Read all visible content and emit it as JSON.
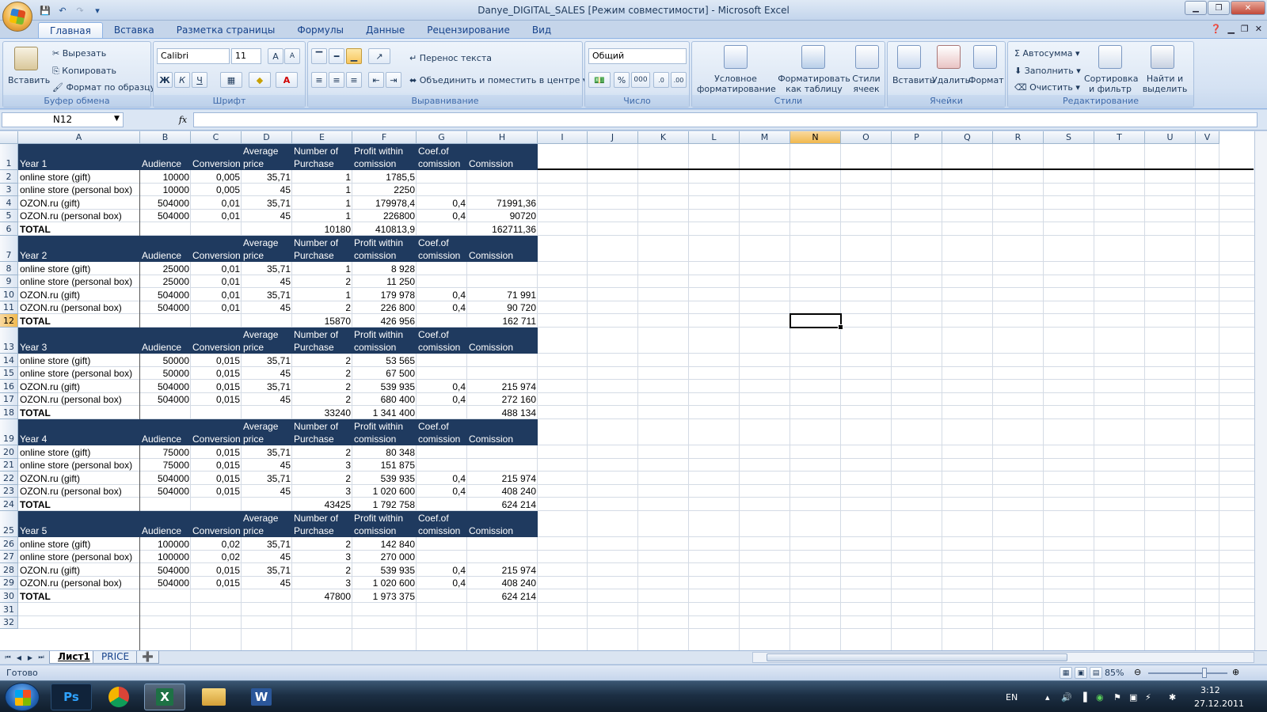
{
  "window": {
    "title": "Danye_DIGITAL_SALES  [Режим совместимости] - Microsoft Excel"
  },
  "tabs": [
    "Главная",
    "Вставка",
    "Разметка страницы",
    "Формулы",
    "Данные",
    "Рецензирование",
    "Вид"
  ],
  "ribbon": {
    "clipboard": {
      "paste": "Вставить",
      "cut": "Вырезать",
      "copy": "Копировать",
      "format_painter": "Формат по образцу",
      "label": "Буфер обмена"
    },
    "font": {
      "name": "Calibri",
      "size": "11",
      "bold": "Ж",
      "italic": "К",
      "underline": "Ч",
      "label": "Шрифт"
    },
    "alignment": {
      "wrap": "Перенос текста",
      "merge": "Объединить и поместить в центре",
      "label": "Выравнивание"
    },
    "number": {
      "format": "Общий",
      "percent": "%",
      "thousands": "000",
      "label": "Число"
    },
    "styles": {
      "conditional": "Условное форматирование",
      "as_table": "Форматировать как таблицу",
      "cell_styles": "Стили ячеек",
      "label": "Стили"
    },
    "cells": {
      "insert": "Вставить",
      "delete": "Удалить",
      "format": "Формат",
      "label": "Ячейки"
    },
    "editing": {
      "autosum": "Автосумма",
      "fill": "Заполнить",
      "clear": "Очистить",
      "sort": "Сортировка и фильтр",
      "find": "Найти и выделить",
      "label": "Редактирование"
    }
  },
  "formula_bar": {
    "name_box": "N12",
    "fx": "fx",
    "value": ""
  },
  "columns": [
    "A",
    "B",
    "C",
    "D",
    "E",
    "F",
    "G",
    "H",
    "I",
    "J",
    "K",
    "L",
    "M",
    "N",
    "O",
    "P",
    "Q",
    "R",
    "S",
    "T",
    "U",
    "V"
  ],
  "selected": {
    "column": "N",
    "row": 12
  },
  "header_labels": [
    "Audience",
    "Conversion",
    "Average\nprice",
    "Number of\nPurchase",
    "Profit within\ncomission",
    "Coef.of\ncomission",
    "Comission"
  ],
  "blocks": [
    {
      "header_row": 1,
      "year": "Year 1",
      "rows": [
        {
          "row": 2,
          "a": "online store (gift)",
          "b": "10000",
          "c": "0,005",
          "d": "35,71",
          "e": "1",
          "f": "1785,5",
          "g": "",
          "h": ""
        },
        {
          "row": 3,
          "a": "online store (personal box)",
          "b": "10000",
          "c": "0,005",
          "d": "45",
          "e": "1",
          "f": "2250",
          "g": "",
          "h": ""
        },
        {
          "row": 4,
          "a": "OZON.ru (gift)",
          "b": "504000",
          "c": "0,01",
          "d": "35,71",
          "e": "1",
          "f": "179978,4",
          "g": "0,4",
          "h": "71991,36"
        },
        {
          "row": 5,
          "a": "OZON.ru (personal box)",
          "b": "504000",
          "c": "0,01",
          "d": "45",
          "e": "1",
          "f": "226800",
          "g": "0,4",
          "h": "90720"
        }
      ],
      "total": {
        "row": 6,
        "a": "TOTAL",
        "e": "10180",
        "f": "410813,9",
        "h": "162711,36"
      }
    },
    {
      "header_row": 7,
      "year": "Year 2",
      "rows": [
        {
          "row": 8,
          "a": "online store (gift)",
          "b": "25000",
          "c": "0,01",
          "d": "35,71",
          "e": "1",
          "f": "8 928",
          "g": "",
          "h": ""
        },
        {
          "row": 9,
          "a": "online store (personal box)",
          "b": "25000",
          "c": "0,01",
          "d": "45",
          "e": "2",
          "f": "11 250",
          "g": "",
          "h": ""
        },
        {
          "row": 10,
          "a": "OZON.ru (gift)",
          "b": "504000",
          "c": "0,01",
          "d": "35,71",
          "e": "1",
          "f": "179 978",
          "g": "0,4",
          "h": "71 991"
        },
        {
          "row": 11,
          "a": "OZON.ru (personal box)",
          "b": "504000",
          "c": "0,01",
          "d": "45",
          "e": "2",
          "f": "226 800",
          "g": "0,4",
          "h": "90 720"
        }
      ],
      "total": {
        "row": 12,
        "a": "TOTAL",
        "e": "15870",
        "f": "426 956",
        "h": "162 711"
      }
    },
    {
      "header_row": 13,
      "year": "Year 3",
      "rows": [
        {
          "row": 14,
          "a": "online store (gift)",
          "b": "50000",
          "c": "0,015",
          "d": "35,71",
          "e": "2",
          "f": "53 565",
          "g": "",
          "h": ""
        },
        {
          "row": 15,
          "a": "online store (personal box)",
          "b": "50000",
          "c": "0,015",
          "d": "45",
          "e": "2",
          "f": "67 500",
          "g": "",
          "h": ""
        },
        {
          "row": 16,
          "a": "OZON.ru (gift)",
          "b": "504000",
          "c": "0,015",
          "d": "35,71",
          "e": "2",
          "f": "539 935",
          "g": "0,4",
          "h": "215 974"
        },
        {
          "row": 17,
          "a": "OZON.ru (personal box)",
          "b": "504000",
          "c": "0,015",
          "d": "45",
          "e": "2",
          "f": "680 400",
          "g": "0,4",
          "h": "272 160"
        }
      ],
      "total": {
        "row": 18,
        "a": "TOTAL",
        "e": "33240",
        "f": "1 341 400",
        "h": "488 134"
      }
    },
    {
      "header_row": 19,
      "year": "Year 4",
      "rows": [
        {
          "row": 20,
          "a": "online store (gift)",
          "b": "75000",
          "c": "0,015",
          "d": "35,71",
          "e": "2",
          "f": "80 348",
          "g": "",
          "h": ""
        },
        {
          "row": 21,
          "a": "online store (personal box)",
          "b": "75000",
          "c": "0,015",
          "d": "45",
          "e": "3",
          "f": "151 875",
          "g": "",
          "h": ""
        },
        {
          "row": 22,
          "a": "OZON.ru (gift)",
          "b": "504000",
          "c": "0,015",
          "d": "35,71",
          "e": "2",
          "f": "539 935",
          "g": "0,4",
          "h": "215 974"
        },
        {
          "row": 23,
          "a": "OZON.ru (personal box)",
          "b": "504000",
          "c": "0,015",
          "d": "45",
          "e": "3",
          "f": "1 020 600",
          "g": "0,4",
          "h": "408 240"
        }
      ],
      "total": {
        "row": 24,
        "a": "TOTAL",
        "e": "43425",
        "f": "1 792 758",
        "h": "624 214"
      }
    },
    {
      "header_row": 25,
      "year": "Year 5",
      "rows": [
        {
          "row": 26,
          "a": "online store (gift)",
          "b": "100000",
          "c": "0,02",
          "d": "35,71",
          "e": "2",
          "f": "142 840",
          "g": "",
          "h": ""
        },
        {
          "row": 27,
          "a": "online store (personal box)",
          "b": "100000",
          "c": "0,02",
          "d": "45",
          "e": "3",
          "f": "270 000",
          "g": "",
          "h": ""
        },
        {
          "row": 28,
          "a": "OZON.ru (gift)",
          "b": "504000",
          "c": "0,015",
          "d": "35,71",
          "e": "2",
          "f": "539 935",
          "g": "0,4",
          "h": "215 974"
        },
        {
          "row": 29,
          "a": "OZON.ru (personal box)",
          "b": "504000",
          "c": "0,015",
          "d": "45",
          "e": "3",
          "f": "1 020 600",
          "g": "0,4",
          "h": "408 240"
        }
      ],
      "total": {
        "row": 30,
        "a": "TOTAL",
        "e": "47800",
        "f": "1 973 375",
        "h": "624 214"
      }
    }
  ],
  "sheet_tabs": [
    "Лист1",
    "PRICE"
  ],
  "active_sheet": "Лист1",
  "status": {
    "ready": "Готово",
    "zoom": "85%"
  },
  "taskbar": {
    "lang": "EN",
    "time": "3:12",
    "date": "27.12.2011",
    "apps": [
      "Ps",
      "Chrome",
      "Excel",
      "Folder",
      "Word"
    ]
  },
  "colors": {
    "header_band": "#1f3a5f",
    "selection": "#f1b94e"
  }
}
